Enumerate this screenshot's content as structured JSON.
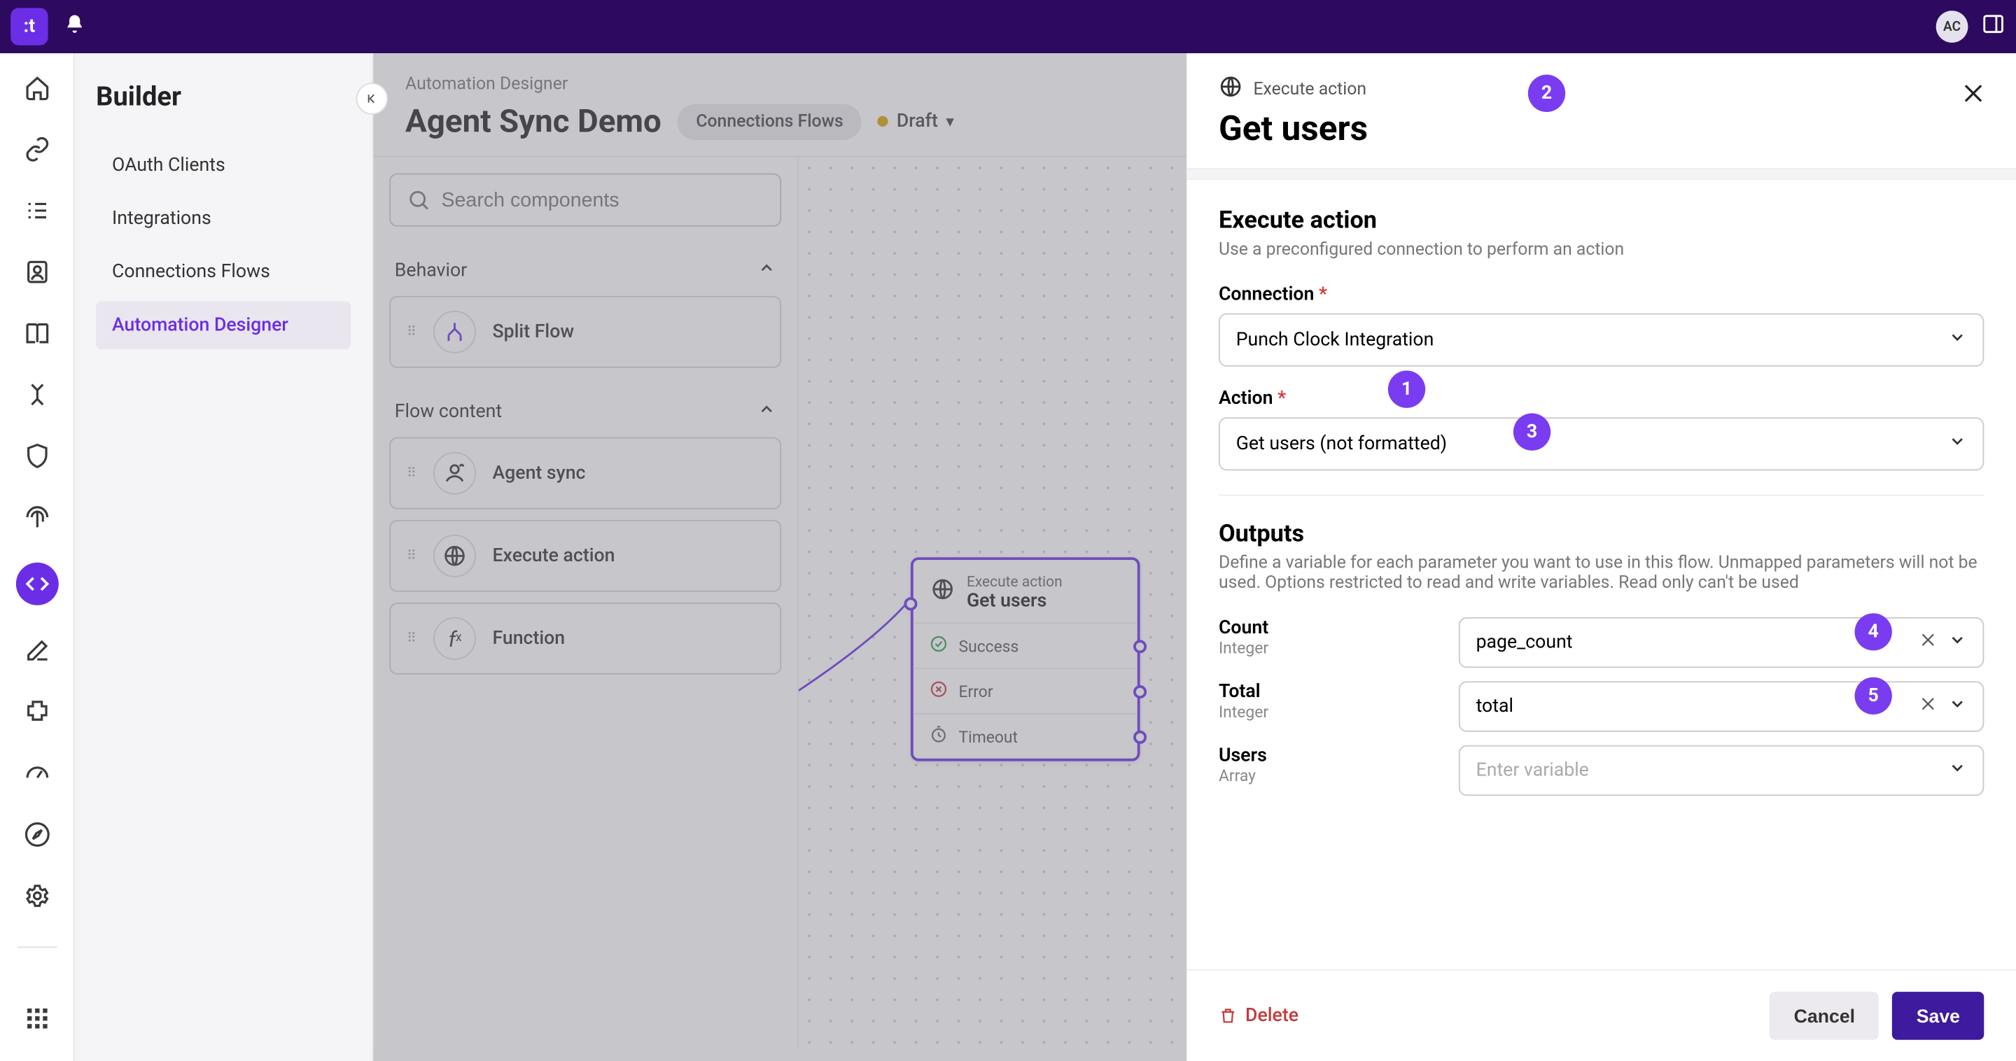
{
  "topbar": {
    "avatar_initials": "AC"
  },
  "sidebar": {
    "title": "Builder",
    "items": [
      {
        "label": "OAuth Clients"
      },
      {
        "label": "Integrations"
      },
      {
        "label": "Connections Flows"
      },
      {
        "label": "Automation Designer"
      }
    ]
  },
  "header": {
    "breadcrumb": "Automation Designer",
    "title": "Agent Sync Demo",
    "chip": "Connections Flows",
    "status": "Draft"
  },
  "palette": {
    "search_placeholder": "Search components",
    "sections": [
      {
        "title": "Behavior",
        "items": [
          {
            "label": "Split Flow"
          }
        ]
      },
      {
        "title": "Flow content",
        "items": [
          {
            "label": "Agent sync"
          },
          {
            "label": "Execute action"
          },
          {
            "label": "Function"
          }
        ]
      }
    ]
  },
  "node": {
    "subtitle": "Execute action",
    "title": "Get users",
    "rows": [
      {
        "label": "Success"
      },
      {
        "label": "Error"
      },
      {
        "label": "Timeout"
      }
    ]
  },
  "panel": {
    "subtitle": "Execute action",
    "title": "Get users",
    "section1_title": "Execute action",
    "section1_desc": "Use a preconfigured connection to perform an action",
    "connection_label": "Connection",
    "connection_value": "Punch Clock Integration",
    "action_label": "Action",
    "action_value": "Get users (not formatted)",
    "outputs_title": "Outputs",
    "outputs_desc": "Define a variable for each parameter you want to use in this flow. Unmapped parameters will not be used. Options restricted to read and write variables. Read only can't be used",
    "outputs": [
      {
        "name": "Count",
        "type": "Integer",
        "value": "page_count"
      },
      {
        "name": "Total",
        "type": "Integer",
        "value": "total"
      },
      {
        "name": "Users",
        "type": "Array",
        "value": "",
        "placeholder": "Enter variable"
      }
    ],
    "delete_label": "Delete",
    "cancel_label": "Cancel",
    "save_label": "Save"
  },
  "markers": {
    "m1": "1",
    "m2": "2",
    "m3": "3",
    "m4": "4",
    "m5": "5"
  }
}
